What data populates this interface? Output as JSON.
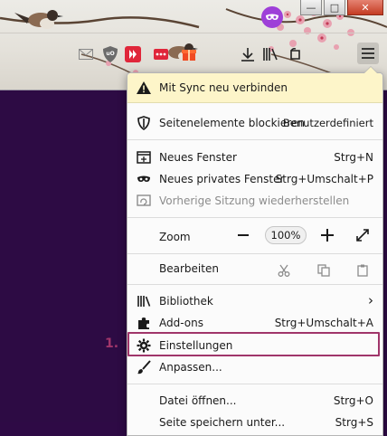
{
  "window_controls": {
    "minimize_glyph": "—",
    "maximize_glyph": "□",
    "close_glyph": "✕"
  },
  "toolbar": {
    "icons": [
      "mail-icon",
      "ublock-icon",
      "video-download-icon",
      "more-dots-icon",
      "gift-icon",
      "bird-icon",
      "download-icon",
      "library-icon",
      "extension-icon",
      "menu-icon"
    ],
    "ublock_text": "uO"
  },
  "menu": {
    "sync": "Mit Sync neu verbinden",
    "blocking": {
      "label": "Seitenelemente blockieren",
      "value": "Benutzerdefiniert"
    },
    "new_window": {
      "label": "Neues Fenster",
      "shortcut": "Strg+N"
    },
    "private_window": {
      "label": "Neues privates Fenster",
      "shortcut": "Strg+Umschalt+P"
    },
    "restore_session": {
      "label": "Vorherige Sitzung wiederherstellen"
    },
    "zoom": {
      "label": "Zoom",
      "minus": "−",
      "value": "100%",
      "plus": "+"
    },
    "edit": {
      "label": "Bearbeiten"
    },
    "library": {
      "label": "Bibliothek",
      "chevron": "›"
    },
    "addons": {
      "label": "Add-ons",
      "shortcut": "Strg+Umschalt+A"
    },
    "settings": {
      "label": "Einstellungen"
    },
    "customize": {
      "label": "Anpassen..."
    },
    "open_file": {
      "label": "Datei öffnen...",
      "shortcut": "Strg+O"
    },
    "save_page": {
      "label": "Seite speichern unter...",
      "shortcut": "Strg+S"
    }
  },
  "annotation": {
    "step": "1."
  },
  "colors": {
    "highlight": "#a0356a",
    "sync_banner": "#fdf5c9",
    "content_bg": "#2d0b44",
    "private_badge": "#9e3fd8"
  }
}
